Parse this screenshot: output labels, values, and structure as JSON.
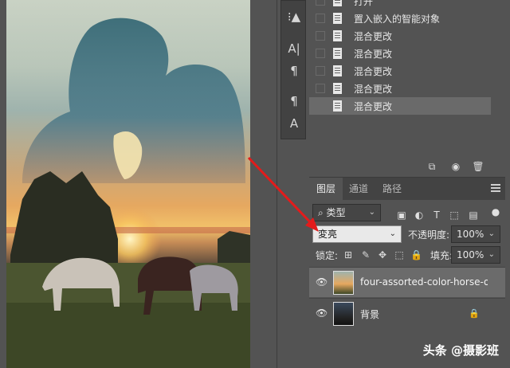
{
  "history": {
    "items": [
      {
        "label": "打开",
        "active": false
      },
      {
        "label": "置入嵌入的智能对象",
        "active": false
      },
      {
        "label": "混合更改",
        "active": false
      },
      {
        "label": "混合更改",
        "active": false
      },
      {
        "label": "混合更改",
        "active": false
      },
      {
        "label": "混合更改",
        "active": false
      },
      {
        "label": "混合更改",
        "active": true
      }
    ]
  },
  "tools": [
    {
      "icon": "person-list-icon",
      "glyph": "⁝▲"
    },
    {
      "icon": "character-icon",
      "glyph": "A|"
    },
    {
      "icon": "paragraph-icon",
      "glyph": "¶"
    },
    {
      "icon": "paragraph-style-icon",
      "glyph": "¶"
    },
    {
      "icon": "character-style-icon",
      "glyph": "A"
    }
  ],
  "layers_panel": {
    "tabs": [
      {
        "label": "图层",
        "active": true
      },
      {
        "label": "通道",
        "active": false
      },
      {
        "label": "路径",
        "active": false
      }
    ],
    "filter": {
      "label": "类型"
    },
    "blend_mode": "変亮",
    "opacity_label": "不透明度:",
    "opacity_value": "100%",
    "lock_label": "锁定:",
    "fill_label": "填充:",
    "fill_value": "100%",
    "layers": [
      {
        "name": "four-assorted-color-horse-o...",
        "active": true,
        "locked": false
      },
      {
        "name": "背景",
        "active": false,
        "locked": true
      }
    ]
  },
  "watermark": "头条 @摄影班",
  "colors": {
    "panel_bg": "#535353",
    "active_row": "#6b6b6b",
    "arrow": "#e31b1b"
  }
}
